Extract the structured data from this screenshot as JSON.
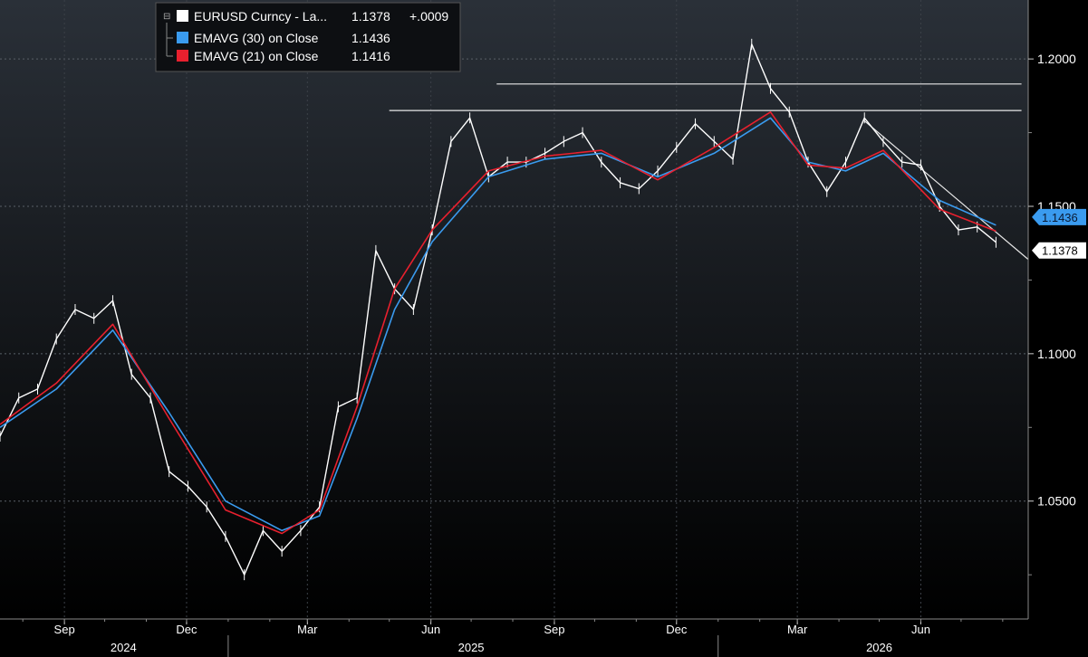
{
  "legend": {
    "items": [
      {
        "label": "EURUSD Curncy - La...",
        "value": "1.1378",
        "change": "+.0009",
        "color": "#ffffff"
      },
      {
        "label": "EMAVG (30)  on Close",
        "value": "1.1436",
        "change": "",
        "color": "#3a9bef"
      },
      {
        "label": "EMAVG (21)  on Close",
        "value": "1.1416",
        "change": "",
        "color": "#e8202e"
      }
    ]
  },
  "chart_data": {
    "type": "line",
    "ylim": [
      1.01,
      1.22
    ],
    "yticks": [
      "1.0500",
      "1.1000",
      "1.1500",
      "1.2000"
    ],
    "ytick_values": [
      1.05,
      1.1,
      1.15,
      1.2
    ],
    "xlim": [
      "2024-07-15",
      "2026-08-20"
    ],
    "month_ticks": [
      {
        "label": "Sep",
        "date": "2024-09-01"
      },
      {
        "label": "Dec",
        "date": "2024-12-01"
      },
      {
        "label": "Mar",
        "date": "2025-03-01"
      },
      {
        "label": "Jun",
        "date": "2025-06-01"
      },
      {
        "label": "Sep",
        "date": "2025-09-01"
      },
      {
        "label": "Dec",
        "date": "2025-12-01"
      },
      {
        "label": "Mar",
        "date": "2026-03-01"
      },
      {
        "label": "Jun",
        "date": "2026-06-01"
      }
    ],
    "year_labels": [
      {
        "label": "2024",
        "date": "2024-10-15"
      },
      {
        "label": "2025",
        "date": "2025-07-01"
      },
      {
        "label": "2026",
        "date": "2026-05-01"
      }
    ],
    "year_dividers": [
      "2025-01-01",
      "2026-01-01"
    ],
    "last_price_labels": [
      {
        "text": "1.1436",
        "value": 1.1436,
        "color": "#3a9bef"
      },
      {
        "text": "1.1378",
        "value": 1.1378,
        "color": "#ffffff"
      }
    ],
    "annotations": [
      {
        "type": "hline",
        "from": "2025-05-01",
        "to": "2026-08-15",
        "y": 1.1825
      },
      {
        "type": "hline",
        "from": "2025-07-20",
        "to": "2026-08-15",
        "y": 1.1915
      },
      {
        "type": "trendline",
        "from": "2026-04-20",
        "from_y": 1.179,
        "to": "2026-08-20",
        "to_y": 1.132
      }
    ],
    "series": [
      {
        "name": "EURUSD Curncy - La...",
        "color": "#ffffff",
        "x": [
          "2024-07-15",
          "2024-07-29",
          "2024-08-12",
          "2024-08-26",
          "2024-09-09",
          "2024-09-23",
          "2024-10-07",
          "2024-10-21",
          "2024-11-04",
          "2024-11-18",
          "2024-12-02",
          "2024-12-16",
          "2024-12-30",
          "2025-01-13",
          "2025-01-27",
          "2025-02-10",
          "2025-02-24",
          "2025-03-10",
          "2025-03-24",
          "2025-04-07",
          "2025-04-21",
          "2025-05-05",
          "2025-05-19",
          "2025-06-02",
          "2025-06-16",
          "2025-06-30",
          "2025-07-14",
          "2025-07-28",
          "2025-08-11",
          "2025-08-25",
          "2025-09-08",
          "2025-09-22",
          "2025-10-06",
          "2025-10-20",
          "2025-11-03",
          "2025-11-17",
          "2025-12-01",
          "2025-12-15",
          "2025-12-29",
          "2026-01-12",
          "2026-01-26",
          "2026-02-09",
          "2026-02-23",
          "2026-03-09",
          "2026-03-23",
          "2026-04-06",
          "2026-04-20",
          "2026-05-04",
          "2026-05-18",
          "2026-06-01",
          "2026-06-15",
          "2026-06-29",
          "2026-07-13",
          "2026-07-27"
        ],
        "values": [
          1.072,
          1.085,
          1.088,
          1.105,
          1.115,
          1.112,
          1.118,
          1.093,
          1.085,
          1.06,
          1.055,
          1.048,
          1.038,
          1.025,
          1.04,
          1.033,
          1.04,
          1.048,
          1.082,
          1.085,
          1.135,
          1.122,
          1.115,
          1.142,
          1.172,
          1.18,
          1.16,
          1.165,
          1.165,
          1.168,
          1.172,
          1.175,
          1.165,
          1.158,
          1.156,
          1.162,
          1.17,
          1.178,
          1.172,
          1.166,
          1.205,
          1.19,
          1.182,
          1.165,
          1.155,
          1.165,
          1.18,
          1.172,
          1.165,
          1.164,
          1.15,
          1.142,
          1.143,
          1.1378
        ]
      },
      {
        "name": "EMAVG (30)  on Close",
        "color": "#3a9bef",
        "x": [
          "2024-07-15",
          "2024-08-26",
          "2024-10-07",
          "2024-11-18",
          "2024-12-30",
          "2025-02-10",
          "2025-03-10",
          "2025-04-07",
          "2025-05-05",
          "2025-06-02",
          "2025-07-14",
          "2025-08-25",
          "2025-10-06",
          "2025-11-17",
          "2025-12-29",
          "2026-02-09",
          "2026-03-09",
          "2026-04-06",
          "2026-05-04",
          "2026-06-15",
          "2026-07-27"
        ],
        "values": [
          1.075,
          1.088,
          1.108,
          1.08,
          1.05,
          1.04,
          1.045,
          1.078,
          1.115,
          1.138,
          1.16,
          1.166,
          1.168,
          1.16,
          1.168,
          1.18,
          1.165,
          1.162,
          1.168,
          1.152,
          1.1436
        ]
      },
      {
        "name": "EMAVG (21)  on Close",
        "color": "#e8202e",
        "x": [
          "2024-07-15",
          "2024-08-26",
          "2024-10-07",
          "2024-11-18",
          "2024-12-30",
          "2025-02-10",
          "2025-03-10",
          "2025-04-07",
          "2025-05-05",
          "2025-06-02",
          "2025-07-14",
          "2025-08-25",
          "2025-10-06",
          "2025-11-17",
          "2025-12-29",
          "2026-02-09",
          "2026-03-09",
          "2026-04-06",
          "2026-05-04",
          "2026-06-15",
          "2026-07-27"
        ],
        "values": [
          1.076,
          1.09,
          1.11,
          1.078,
          1.047,
          1.039,
          1.047,
          1.082,
          1.122,
          1.142,
          1.162,
          1.167,
          1.169,
          1.159,
          1.17,
          1.182,
          1.164,
          1.163,
          1.169,
          1.149,
          1.1416
        ]
      }
    ]
  }
}
